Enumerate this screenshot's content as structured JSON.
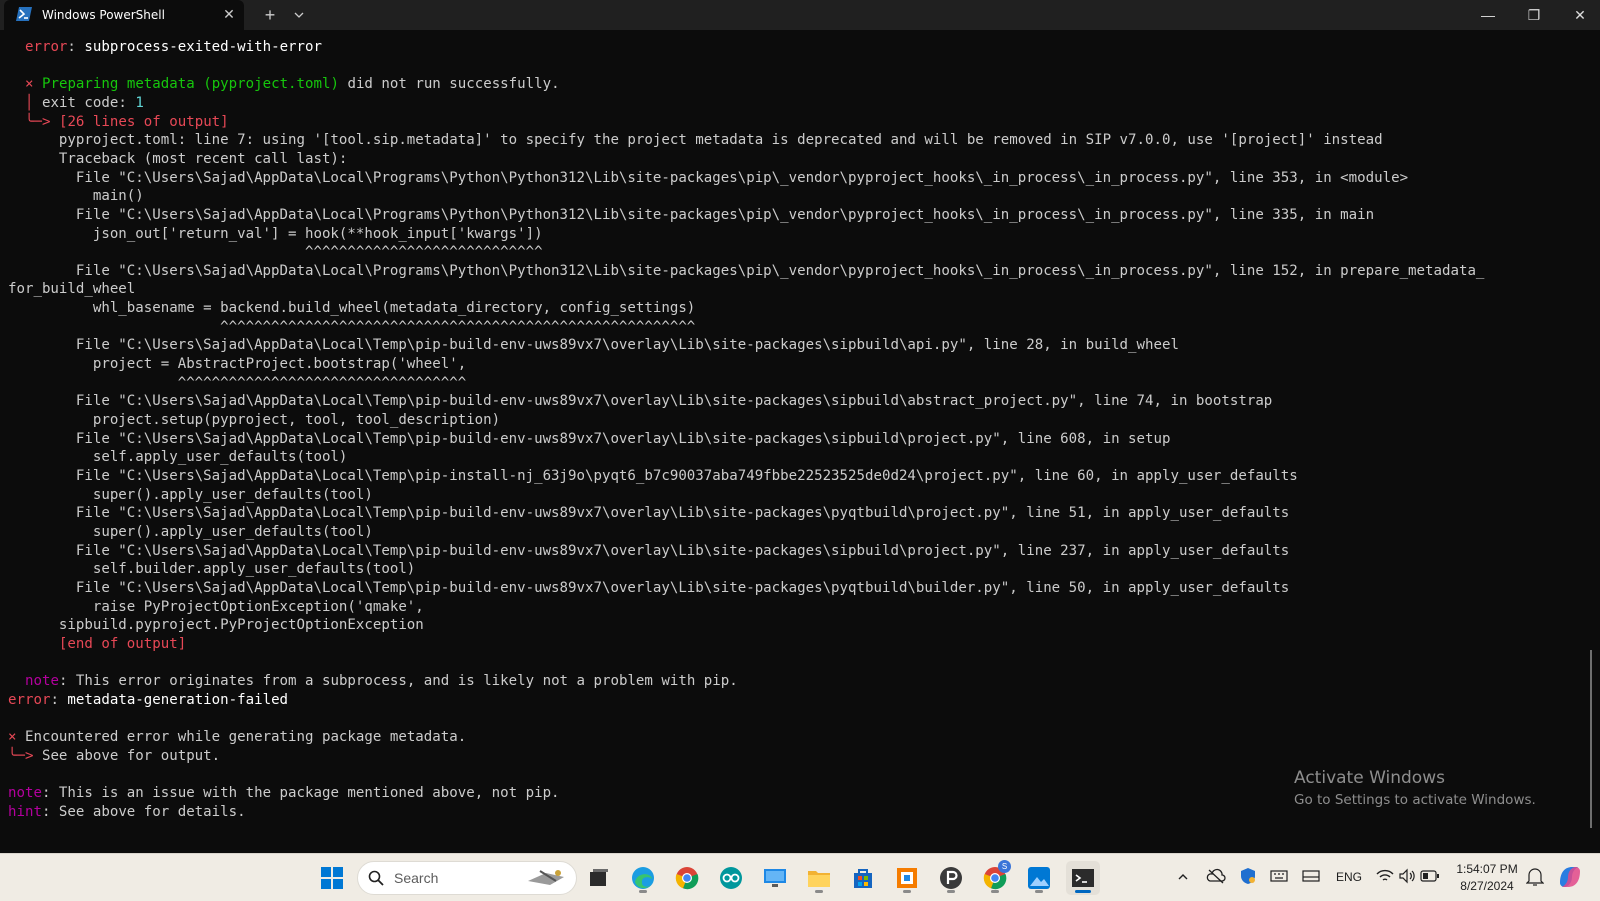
{
  "window": {
    "tab_title": "Windows PowerShell",
    "tab_icon": "powershell-icon",
    "close_tab": "✕",
    "new_tab": "+",
    "minimize": "—",
    "maximize": "❐",
    "close": "✕"
  },
  "terminal": {
    "lines": [
      {
        "segs": [
          {
            "t": "  "
          },
          {
            "t": "error",
            "c": "red"
          },
          {
            "t": ": "
          },
          {
            "t": "subprocess-exited-with-error",
            "c": "white"
          }
        ]
      },
      {
        "segs": [
          {
            "t": ""
          }
        ]
      },
      {
        "segs": [
          {
            "t": "  "
          },
          {
            "t": "×",
            "c": "red"
          },
          {
            "t": " "
          },
          {
            "t": "Preparing metadata ",
            "c": "green"
          },
          {
            "t": "(pyproject.toml)",
            "c": "green"
          },
          {
            "t": " did not run successfully."
          }
        ]
      },
      {
        "segs": [
          {
            "t": "  "
          },
          {
            "t": "│",
            "c": "red"
          },
          {
            "t": " exit code: "
          },
          {
            "t": "1",
            "c": "cyan"
          }
        ]
      },
      {
        "segs": [
          {
            "t": "  "
          },
          {
            "t": "╰─>",
            "c": "red"
          },
          {
            "t": " "
          },
          {
            "t": "[26 lines of output]",
            "c": "red"
          }
        ]
      },
      {
        "segs": [
          {
            "t": "      pyproject.toml: line 7: using '[tool.sip.metadata]' to specify the project metadata is deprecated and will be removed in SIP v7.0.0, use '[project]' instead"
          }
        ]
      },
      {
        "segs": [
          {
            "t": "      Traceback (most recent call last):"
          }
        ]
      },
      {
        "segs": [
          {
            "t": "        File \"C:\\Users\\Sajad\\AppData\\Local\\Programs\\Python\\Python312\\Lib\\site-packages\\pip\\_vendor\\pyproject_hooks\\_in_process\\_in_process.py\", line 353, in <module>"
          }
        ]
      },
      {
        "segs": [
          {
            "t": "          main()"
          }
        ]
      },
      {
        "segs": [
          {
            "t": "        File \"C:\\Users\\Sajad\\AppData\\Local\\Programs\\Python\\Python312\\Lib\\site-packages\\pip\\_vendor\\pyproject_hooks\\_in_process\\_in_process.py\", line 335, in main"
          }
        ]
      },
      {
        "segs": [
          {
            "t": "          json_out['return_val'] = hook(**hook_input['kwargs'])"
          }
        ]
      },
      {
        "segs": [
          {
            "t": "                                   ^^^^^^^^^^^^^^^^^^^^^^^^^^^^"
          }
        ]
      },
      {
        "segs": [
          {
            "t": "        File \"C:\\Users\\Sajad\\AppData\\Local\\Programs\\Python\\Python312\\Lib\\site-packages\\pip\\_vendor\\pyproject_hooks\\_in_process\\_in_process.py\", line 152, in prepare_metadata_"
          }
        ]
      },
      {
        "segs": [
          {
            "t": "for_build_wheel"
          }
        ]
      },
      {
        "segs": [
          {
            "t": "          whl_basename = backend.build_wheel(metadata_directory, config_settings)"
          }
        ]
      },
      {
        "segs": [
          {
            "t": "                         ^^^^^^^^^^^^^^^^^^^^^^^^^^^^^^^^^^^^^^^^^^^^^^^^^^^^^^^^"
          }
        ]
      },
      {
        "segs": [
          {
            "t": "        File \"C:\\Users\\Sajad\\AppData\\Local\\Temp\\pip-build-env-uws89vx7\\overlay\\Lib\\site-packages\\sipbuild\\api.py\", line 28, in build_wheel"
          }
        ]
      },
      {
        "segs": [
          {
            "t": "          project = AbstractProject.bootstrap('wheel',"
          }
        ]
      },
      {
        "segs": [
          {
            "t": "                    ^^^^^^^^^^^^^^^^^^^^^^^^^^^^^^^^^^"
          }
        ]
      },
      {
        "segs": [
          {
            "t": "        File \"C:\\Users\\Sajad\\AppData\\Local\\Temp\\pip-build-env-uws89vx7\\overlay\\Lib\\site-packages\\sipbuild\\abstract_project.py\", line 74, in bootstrap"
          }
        ]
      },
      {
        "segs": [
          {
            "t": "          project.setup(pyproject, tool, tool_description)"
          }
        ]
      },
      {
        "segs": [
          {
            "t": "        File \"C:\\Users\\Sajad\\AppData\\Local\\Temp\\pip-build-env-uws89vx7\\overlay\\Lib\\site-packages\\sipbuild\\project.py\", line 608, in setup"
          }
        ]
      },
      {
        "segs": [
          {
            "t": "          self.apply_user_defaults(tool)"
          }
        ]
      },
      {
        "segs": [
          {
            "t": "        File \"C:\\Users\\Sajad\\AppData\\Local\\Temp\\pip-install-nj_63j9o\\pyqt6_b7c90037aba749fbbe22523525de0d24\\project.py\", line 60, in apply_user_defaults"
          }
        ]
      },
      {
        "segs": [
          {
            "t": "          super().apply_user_defaults(tool)"
          }
        ]
      },
      {
        "segs": [
          {
            "t": "        File \"C:\\Users\\Sajad\\AppData\\Local\\Temp\\pip-build-env-uws89vx7\\overlay\\Lib\\site-packages\\pyqtbuild\\project.py\", line 51, in apply_user_defaults"
          }
        ]
      },
      {
        "segs": [
          {
            "t": "          super().apply_user_defaults(tool)"
          }
        ]
      },
      {
        "segs": [
          {
            "t": "        File \"C:\\Users\\Sajad\\AppData\\Local\\Temp\\pip-build-env-uws89vx7\\overlay\\Lib\\site-packages\\sipbuild\\project.py\", line 237, in apply_user_defaults"
          }
        ]
      },
      {
        "segs": [
          {
            "t": "          self.builder.apply_user_defaults(tool)"
          }
        ]
      },
      {
        "segs": [
          {
            "t": "        File \"C:\\Users\\Sajad\\AppData\\Local\\Temp\\pip-build-env-uws89vx7\\overlay\\Lib\\site-packages\\pyqtbuild\\builder.py\", line 50, in apply_user_defaults"
          }
        ]
      },
      {
        "segs": [
          {
            "t": "          raise PyProjectOptionException('qmake',"
          }
        ]
      },
      {
        "segs": [
          {
            "t": "      sipbuild.pyproject.PyProjectOptionException"
          }
        ]
      },
      {
        "segs": [
          {
            "t": "      "
          },
          {
            "t": "[end of output]",
            "c": "red"
          }
        ]
      },
      {
        "segs": [
          {
            "t": ""
          }
        ]
      },
      {
        "segs": [
          {
            "t": "  "
          },
          {
            "t": "note",
            "c": "magenta"
          },
          {
            "t": ": This error originates from a subprocess, and is likely not a problem with pip."
          }
        ]
      },
      {
        "segs": [
          {
            "t": "error",
            "c": "red"
          },
          {
            "t": ": "
          },
          {
            "t": "metadata-generation-failed",
            "c": "white"
          }
        ]
      },
      {
        "segs": [
          {
            "t": ""
          }
        ]
      },
      {
        "segs": [
          {
            "t": "×",
            "c": "red"
          },
          {
            "t": " Encountered error while generating package metadata."
          }
        ]
      },
      {
        "segs": [
          {
            "t": "╰─>",
            "c": "red"
          },
          {
            "t": " See above for output."
          }
        ]
      },
      {
        "segs": [
          {
            "t": ""
          }
        ]
      },
      {
        "segs": [
          {
            "t": "note",
            "c": "magenta"
          },
          {
            "t": ": This is an issue with the package mentioned above, not pip."
          }
        ]
      },
      {
        "segs": [
          {
            "t": "hint",
            "c": "magenta"
          },
          {
            "t": ": See above for details."
          }
        ]
      }
    ]
  },
  "watermark": {
    "title": "Activate Windows",
    "subtitle": "Go to Settings to activate Windows."
  },
  "taskbar": {
    "search_placeholder": "Search",
    "apps": [
      {
        "name": "start-button",
        "icon": "windows-logo-icon",
        "running": false
      },
      {
        "name": "task-view",
        "icon": "task-view-icon",
        "running": false
      },
      {
        "name": "edge",
        "icon": "edge-icon",
        "running": true
      },
      {
        "name": "chrome",
        "icon": "chrome-icon",
        "running": false
      },
      {
        "name": "arduino",
        "icon": "arduino-icon",
        "running": false
      },
      {
        "name": "remote-desktop",
        "icon": "monitor-icon",
        "running": false
      },
      {
        "name": "file-explorer",
        "icon": "folder-icon",
        "running": true
      },
      {
        "name": "microsoft-store",
        "icon": "store-icon",
        "running": false
      },
      {
        "name": "app-orange",
        "icon": "orange-app-icon",
        "running": true
      },
      {
        "name": "app-p",
        "icon": "p-app-icon",
        "running": true
      },
      {
        "name": "chrome-profile",
        "icon": "chrome-profile-icon",
        "running": true
      },
      {
        "name": "photos",
        "icon": "photos-icon",
        "running": true
      },
      {
        "name": "terminal",
        "icon": "terminal-icon",
        "running": true,
        "active": true
      }
    ],
    "chrome_badge": "S",
    "tray": {
      "language": "ENG",
      "time": "1:54:07 PM",
      "date": "8/27/2024"
    }
  },
  "colors": {
    "terminal_bg": "#0c0c0c",
    "titlebar_bg": "#202020",
    "error_red": "#e74856",
    "green": "#16c60c",
    "magenta": "#b4009e",
    "taskbar_bg": "#f0ece4",
    "accent": "#0067c0"
  }
}
